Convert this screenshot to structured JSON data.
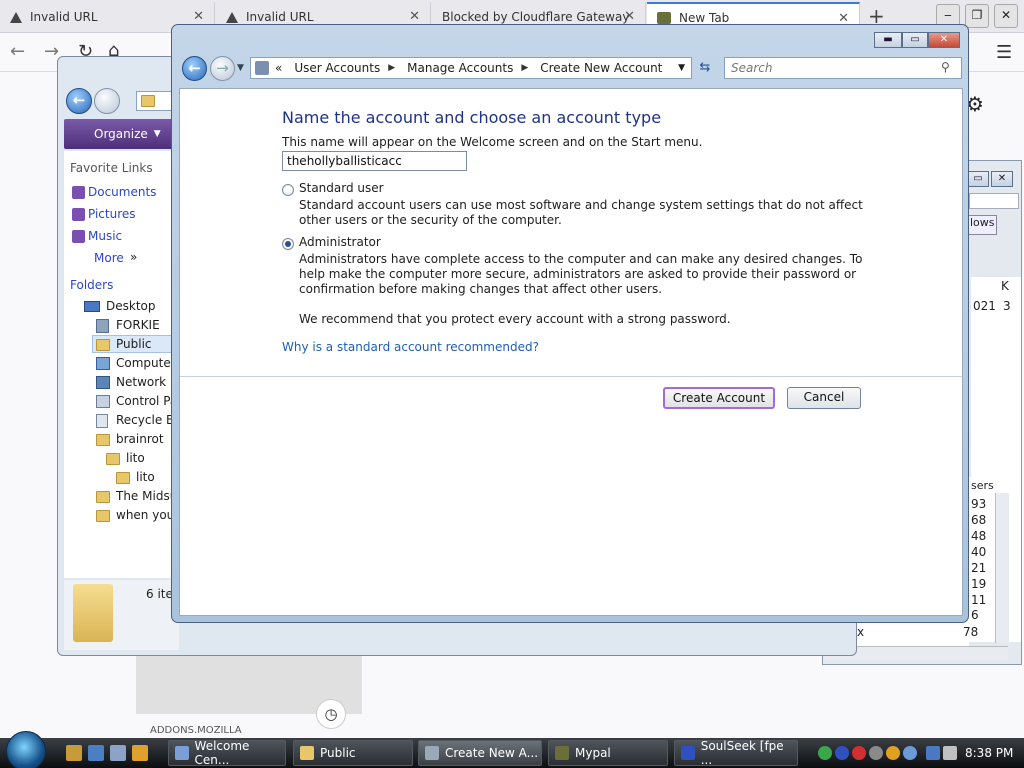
{
  "browser": {
    "tabs": [
      {
        "label": "Invalid URL"
      },
      {
        "label": "Invalid URL"
      },
      {
        "label": "Blocked by Cloudflare Gateway"
      },
      {
        "label": "New Tab"
      }
    ],
    "new_tab": "+",
    "back": "←",
    "forward": "→",
    "reload": "↻",
    "home": "⌂",
    "menu": "☰",
    "gear": "⚙"
  },
  "explorer": {
    "organize_label": "Organize",
    "favorite_links_title": "Favorite Links",
    "favorites": [
      "Documents",
      "Pictures",
      "Music",
      "More"
    ],
    "folders_title": "Folders",
    "tree": [
      "Desktop",
      "FORKIE",
      "Public",
      "Computer",
      "Network",
      "Control Pa",
      "Recycle Bi",
      "brainrot",
      "lito",
      "lito",
      "The Midsu",
      "when you"
    ],
    "item_count": "6 ite"
  },
  "right_window": {
    "tab_label": "lows",
    "col_k": "K",
    "row1": [
      "021",
      "3"
    ],
    "users_header": "sers",
    "numbers": [
      "93",
      "68",
      "48",
      "40",
      "21",
      "19",
      "11",
      "6"
    ],
    "last_row": [
      "x",
      "78"
    ]
  },
  "dialog": {
    "breadcrumb": [
      "User Accounts",
      "Manage Accounts",
      "Create New Account"
    ],
    "breadcrumb_prefix": "«",
    "search_placeholder": "Search",
    "heading": "Name the account and choose an account type",
    "name_hint": "This name will appear on the Welcome screen and on the Start menu.",
    "name_value": "thehollyballisticacc",
    "standard_label": "Standard user",
    "standard_desc": "Standard account users can use most software and change system settings that do not affect other users or the security of the computer.",
    "admin_label": "Administrator",
    "admin_desc": "Administrators have complete access to the computer and can make any desired changes. To help make the computer more secure, administrators are asked to provide their password or confirmation before making changes that affect other users.",
    "recommend": "We recommend that you protect every account with a strong password.",
    "help_link": "Why is a standard account recommended?",
    "create_button": "Create Account",
    "cancel_button": "Cancel",
    "selected_type": "Administrator"
  },
  "web": {
    "addons": "ADDONS.MOZILLA"
  },
  "taskbar": {
    "tasks": [
      "Welcome Cen...",
      "Public",
      "Create New A...",
      "Mypal",
      "SoulSeek [fpe ..."
    ],
    "clock": "8:38 PM"
  }
}
